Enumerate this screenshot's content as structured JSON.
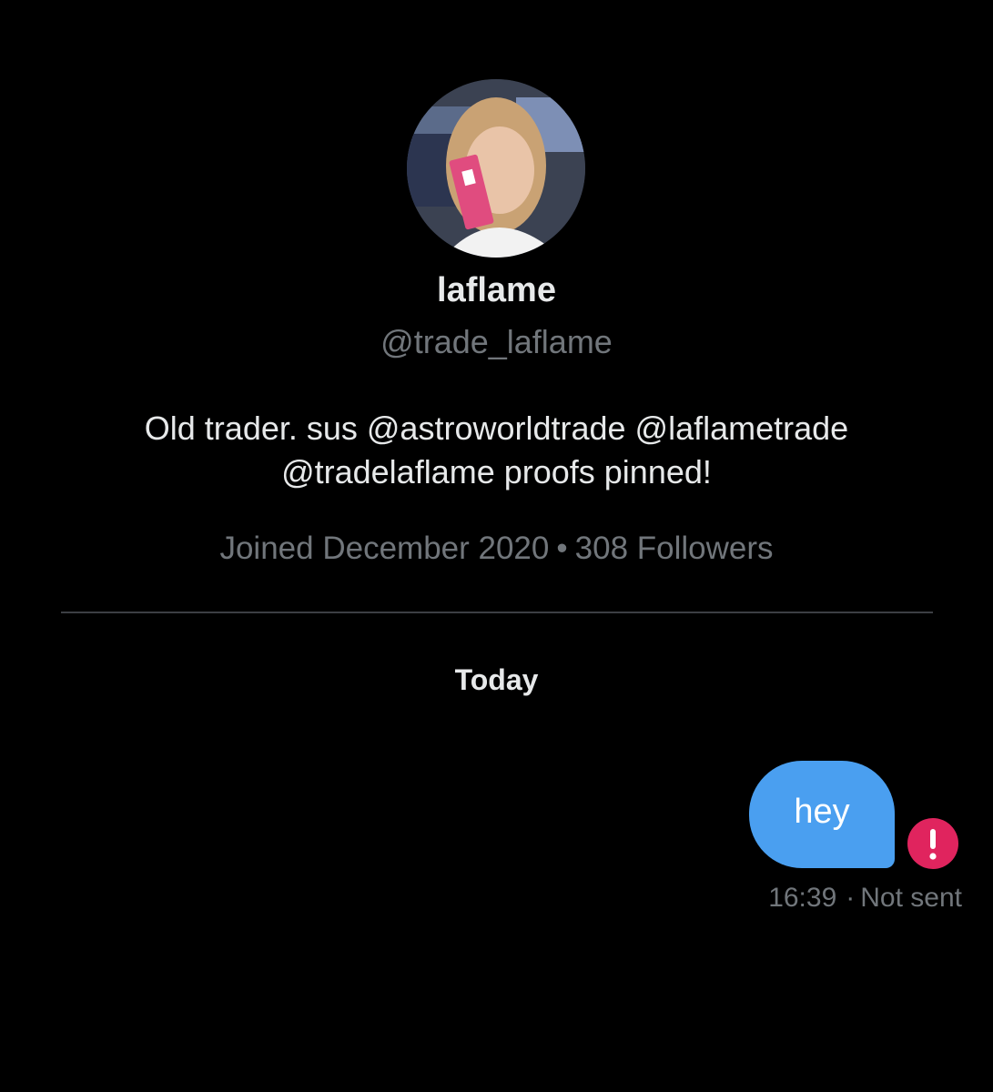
{
  "profile": {
    "display_name": "laflame",
    "handle": "@trade_laflame",
    "bio_line1": "Old trader. sus @astroworldtrade @laflametrade",
    "bio_line2": "@tradelaflame proofs pinned!",
    "joined": "Joined December 2020",
    "separator": "•",
    "followers": "308 Followers"
  },
  "conversation": {
    "day_label": "Today",
    "messages": [
      {
        "text": "hey",
        "time": "16:39",
        "separator": "·",
        "status": "Not sent",
        "status_icon": "error-exclamation-icon"
      }
    ]
  },
  "colors": {
    "background": "#000000",
    "primary_text": "#e7e9ea",
    "secondary_text": "#71767b",
    "bubble": "#4a9ff0",
    "error": "#e0245e"
  }
}
